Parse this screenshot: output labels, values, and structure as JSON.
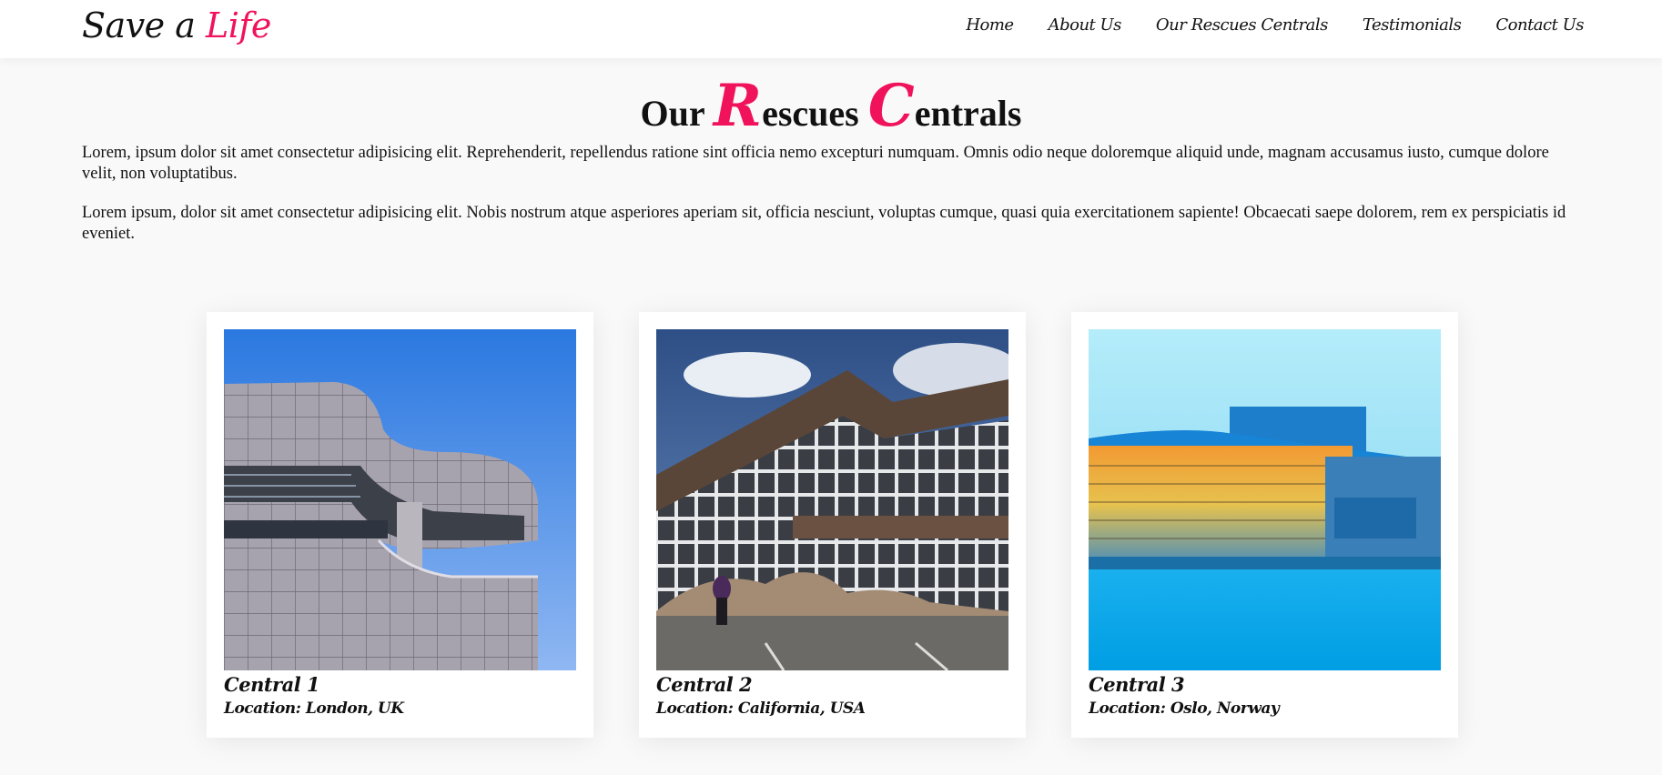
{
  "brand": {
    "prefix": "Save a ",
    "accent": "Life",
    "accent_color": "#f0135c"
  },
  "nav": [
    {
      "label": "Home"
    },
    {
      "label": "About Us"
    },
    {
      "label": "Our Rescues Centrals"
    },
    {
      "label": "Testimonials"
    },
    {
      "label": "Contact Us"
    }
  ],
  "section": {
    "title_word1": "Our ",
    "title_cap1": "R",
    "title_rest1": "escues ",
    "title_cap2": "C",
    "title_rest2": "entrals",
    "paragraph1": "Lorem, ipsum dolor sit amet consectetur adipisicing elit. Reprehenderit, repellendus ratione sint officia nemo excepturi numquam. Omnis odio neque doloremque aliquid unde, magnam accusamus iusto, cumque dolore velit, non voluptatibus.",
    "paragraph2": "Lorem ipsum, dolor sit amet consectetur adipisicing elit. Nobis nostrum atque asperiores aperiam sit, officia nesciunt, voluptas cumque, quasi quia exercitationem sapiente! Obcaecati saepe dolorem, rem ex perspiciatis id eveniet."
  },
  "centrals": [
    {
      "title": "Central 1",
      "location": "Location: London, UK",
      "image": "curved-modern-building-photo"
    },
    {
      "title": "Central 2",
      "location": "Location: California, USA",
      "image": "glass-visitor-center-photo"
    },
    {
      "title": "Central 3",
      "location": "Location: Oslo, Norway",
      "image": "opera-house-waterfront-photo"
    }
  ]
}
